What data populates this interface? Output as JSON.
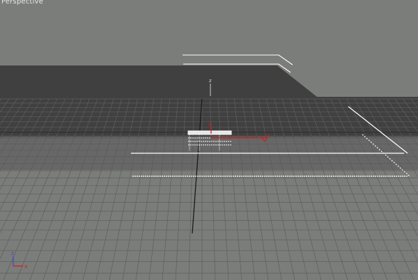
{
  "viewport": {
    "label": "Perspective",
    "background_color": "#7b7d7a",
    "ground_color": "#404040",
    "grid_color": "#5e5e5e",
    "selection_color": "#ffffff"
  },
  "gizmo": {
    "z_label": "z",
    "x_axis_color": "#d21e1e",
    "y_axis_color": "#d21e1e"
  },
  "axis_tripod": {
    "z_label": "z",
    "x_label": "x",
    "z_color": "#3c4fc8",
    "x_color": "#d21e1e"
  },
  "pivot_label": "z"
}
